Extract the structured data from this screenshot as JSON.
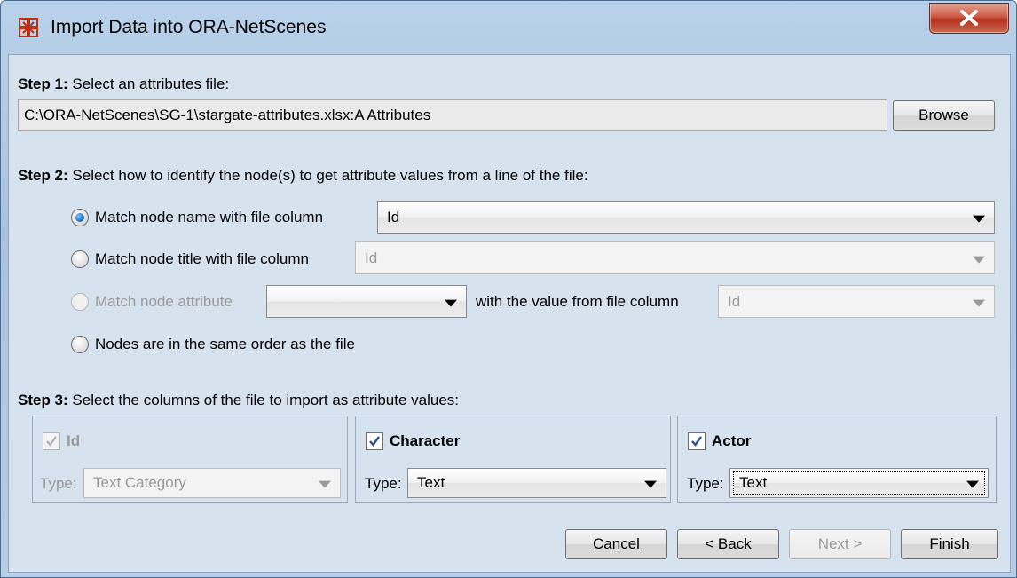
{
  "window": {
    "title": "Import Data into ORA-NetScenes",
    "app_icon": "ora-netscenes-icon",
    "close_icon": "close-icon"
  },
  "step1": {
    "label_bold": "Step 1:",
    "label_text": " Select an attributes file:",
    "file_path": "C:\\ORA-NetScenes\\SG-1\\stargate-attributes.xlsx:A Attributes",
    "browse_label": "Browse"
  },
  "step2": {
    "label_bold": "Step 2:",
    "label_text": " Select how to identify the node(s) to get attribute values from a line of the file:",
    "options": [
      {
        "label": "Match node name with file column",
        "selected": true,
        "enabled": true,
        "combo_value": "Id"
      },
      {
        "label": "Match node title with file column",
        "selected": false,
        "enabled": true,
        "combo_value": "Id"
      },
      {
        "label": "Match node attribute",
        "selected": false,
        "enabled": false,
        "combo_value": "",
        "suffix": "with the value from file column",
        "combo2_value": "Id"
      },
      {
        "label": "Nodes are in the same order as the file",
        "selected": false,
        "enabled": true
      }
    ]
  },
  "step3": {
    "label_bold": "Step 3:",
    "label_text": " Select the columns of the file to import as attribute values:",
    "columns": [
      {
        "name": "Id",
        "checked": true,
        "enabled": false,
        "type_label": "Type:",
        "type_value": "Text Category"
      },
      {
        "name": "Character",
        "checked": true,
        "enabled": true,
        "type_label": "Type:",
        "type_value": "Text"
      },
      {
        "name": "Actor",
        "checked": true,
        "enabled": true,
        "type_label": "Type:",
        "type_value": "Text"
      }
    ]
  },
  "buttons": {
    "cancel": "Cancel",
    "back": "< Back",
    "next": "Next >",
    "finish": "Finish"
  },
  "colors": {
    "frame": "#b9d1ea",
    "content_bg": "#d7e2ef",
    "close_red": "#c9452f",
    "disabled_text": "#9a9a9a"
  }
}
